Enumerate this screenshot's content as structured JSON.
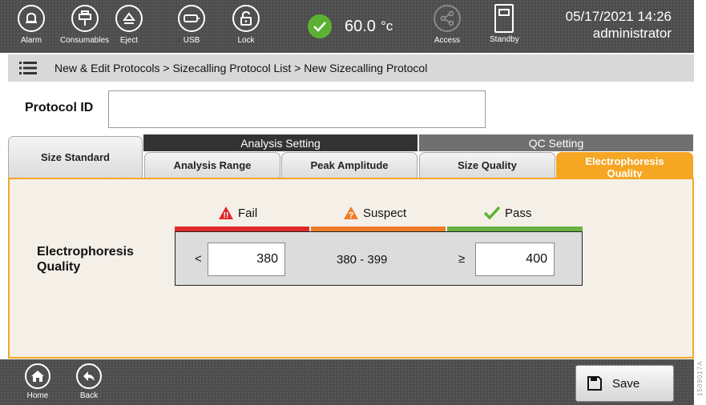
{
  "toolbar": {
    "alarm_label": "Alarm",
    "consumables_label": "Consumables",
    "eject_label": "Eject",
    "usb_label": "USB",
    "lock_label": "Lock",
    "temperature_value": "60.0",
    "temperature_unit": "°c",
    "access_label": "Access",
    "standby_label": "Standby",
    "date_time": "05/17/2021 14:26",
    "user": "administrator"
  },
  "breadcrumb": "New & Edit Protocols > Sizecalling Protocol List > New Sizecalling Protocol",
  "protocol": {
    "id_label": "Protocol ID",
    "id_value": ""
  },
  "tabs": {
    "analysis_group": "Analysis Setting",
    "qc_group": "QC Setting",
    "size_standard": "Size Standard",
    "analysis_range": "Analysis Range",
    "peak_amplitude": "Peak Amplitude",
    "size_quality": "Size Quality",
    "electrophoresis_quality_line1": "Electrophoresis",
    "electrophoresis_quality_line2": "Quality",
    "active": "Electrophoresis Quality"
  },
  "thresholds": {
    "row_label_line1": "Electrophoresis",
    "row_label_line2": "Quality",
    "fail_label": "Fail",
    "suspect_label": "Suspect",
    "pass_label": "Pass",
    "fail_operator": "<",
    "fail_value": "380",
    "suspect_range": "380 - 399",
    "pass_operator": "≥",
    "pass_value": "400"
  },
  "bottom": {
    "home_label": "Home",
    "back_label": "Back",
    "save_label": "Save"
  },
  "figure_id": "1509017A",
  "colors": {
    "accent": "#f5a623",
    "fail": "#e02a2a",
    "suspect": "#ee7d2a",
    "pass": "#6ab144",
    "toolbar": "#4d4d4d"
  }
}
